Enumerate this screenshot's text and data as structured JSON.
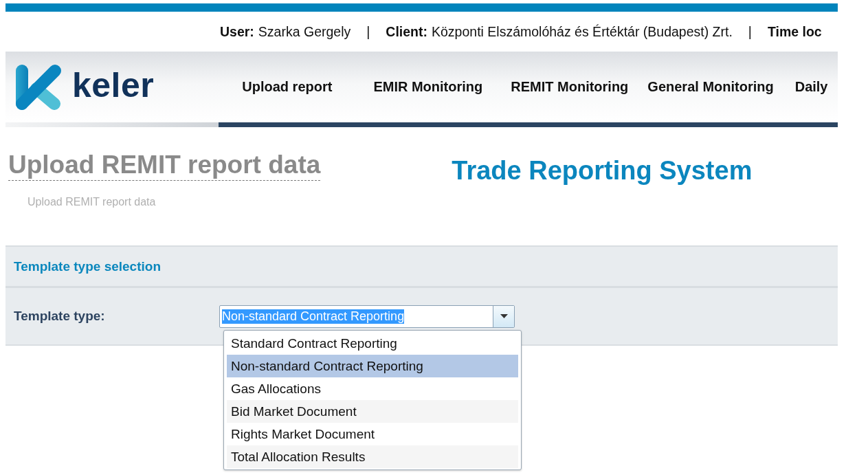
{
  "user_bar": [
    {
      "kind": "field",
      "label": "User:",
      "value": "Szarka Gergely"
    },
    {
      "kind": "separator",
      "text": "|"
    },
    {
      "kind": "field",
      "label": "Client:",
      "value": "Központi Elszámolóház és Értéktár (Budapest) Zrt."
    },
    {
      "kind": "separator",
      "text": "|"
    },
    {
      "kind": "field",
      "label": "Time loc"
    }
  ],
  "brand": {
    "name": "keler"
  },
  "nav": [
    "Upload report",
    "EMIR Monitoring",
    "REMIT Monitoring",
    "General Monitoring",
    "Daily"
  ],
  "page": {
    "title": "Upload REMIT report data",
    "system_title": "Trade Reporting System",
    "breadcrumb": "Upload REMIT report data"
  },
  "panel": {
    "title": "Template type selection",
    "field_label": "Template type:",
    "value": "Non-standard Contract Reporting",
    "options": [
      {
        "label": "Standard Contract Reporting",
        "selected": false
      },
      {
        "label": "Non-standard Contract Reporting",
        "selected": true
      },
      {
        "label": "Gas Allocations",
        "selected": false
      },
      {
        "label": "Bid Market Document",
        "selected": false
      },
      {
        "label": "Rights Market Document",
        "selected": false
      },
      {
        "label": "Total Allocation Results",
        "selected": false
      }
    ]
  }
}
